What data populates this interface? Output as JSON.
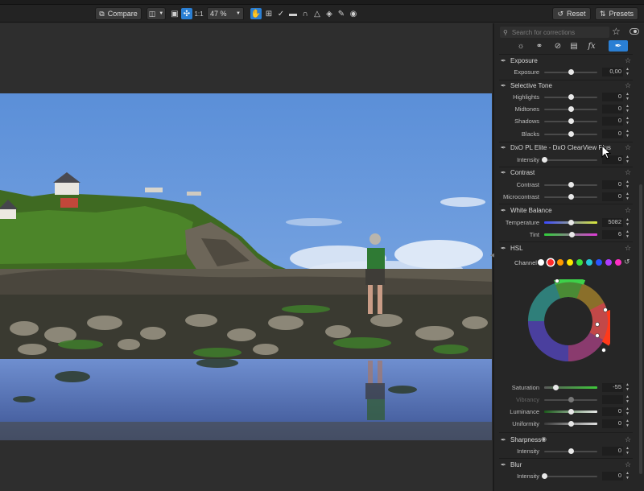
{
  "toolbar": {
    "compare_label": "Compare",
    "ratio_label": "1:1",
    "zoom_value": "47 %",
    "reset_label": "Reset",
    "presets_label": "Presets"
  },
  "search": {
    "placeholder": "Search for corrections"
  },
  "sections": {
    "exposure": {
      "title": "Exposure",
      "rows": [
        {
          "label": "Exposure",
          "value": "0,00",
          "position": 0.5
        }
      ]
    },
    "selective_tone": {
      "title": "Selective Tone",
      "rows": [
        {
          "label": "Highlights",
          "value": "0",
          "position": 0.5
        },
        {
          "label": "Midtones",
          "value": "0",
          "position": 0.5
        },
        {
          "label": "Shadows",
          "value": "0",
          "position": 0.5
        },
        {
          "label": "Blacks",
          "value": "0",
          "position": 0.5
        }
      ]
    },
    "dxo": {
      "title": "DxO PL Elite - DxO ClearView Plus",
      "rows": [
        {
          "label": "Intensity",
          "value": "0",
          "position": 0.0
        }
      ]
    },
    "contrast": {
      "title": "Contrast",
      "rows": [
        {
          "label": "Contrast",
          "value": "0",
          "position": 0.5
        },
        {
          "label": "Microcontrast",
          "value": "0",
          "position": 0.5
        }
      ]
    },
    "white_balance": {
      "title": "White Balance",
      "rows": [
        {
          "label": "Temperature",
          "value": "5082",
          "position": 0.5
        },
        {
          "label": "Tint",
          "value": "6",
          "position": 0.52
        }
      ]
    },
    "hsl": {
      "title": "HSL",
      "channel_label": "Channel",
      "channel_colors": [
        "#ffffff",
        "#ff2a2a",
        "#ff9a00",
        "#ffe600",
        "#3ee23e",
        "#27c8d8",
        "#2a55ff",
        "#b03cff",
        "#ff2fc4"
      ],
      "selected_channel": 1,
      "rows": [
        {
          "label": "Saturation",
          "value": "-55",
          "position": 0.22
        },
        {
          "label": "Vibrancy",
          "value": "",
          "position": 0.5,
          "disabled": true
        },
        {
          "label": "Luminance",
          "value": "0",
          "position": 0.5
        },
        {
          "label": "Uniformity",
          "value": "0",
          "position": 0.5
        }
      ]
    },
    "sharpness": {
      "title": "Sharpness",
      "rows": [
        {
          "label": "Intensity",
          "value": "0",
          "position": 0.5
        }
      ]
    },
    "blur": {
      "title": "Blur",
      "rows": [
        {
          "label": "Intensity",
          "value": "0",
          "position": 0.0
        }
      ]
    }
  },
  "colors": {
    "accent": "#2a7fd4",
    "panel_bg": "#262626"
  }
}
